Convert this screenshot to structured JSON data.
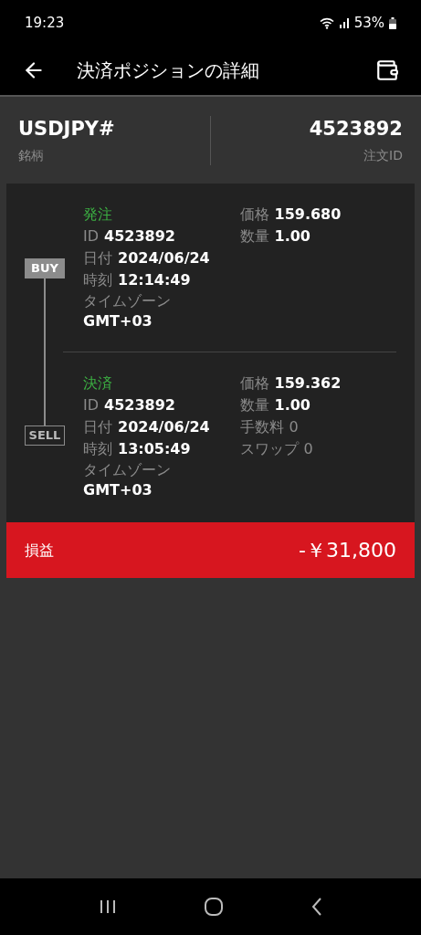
{
  "status_bar": {
    "time": "19:23",
    "battery": "53%"
  },
  "app_bar": {
    "title": "決済ポジションの詳細"
  },
  "summary": {
    "symbol": "USDJPY#",
    "symbol_label": "銘柄",
    "order_id": "4523892",
    "order_id_label": "注文ID"
  },
  "sections": [
    {
      "title": "発注",
      "side": {
        "label": "BUY",
        "kind": "filled"
      },
      "left": [
        {
          "label": "ID",
          "value": "4523892",
          "kind": "inline",
          "emphasis": true
        },
        {
          "label": "日付",
          "value": "2024/06/24",
          "kind": "inline",
          "emphasis": true
        },
        {
          "label": "時刻",
          "value": "12:14:49",
          "kind": "inline",
          "emphasis": true
        },
        {
          "label": "タイムゾーン",
          "value": "GMT+03",
          "kind": "stacked",
          "emphasis": true
        }
      ],
      "right": [
        {
          "label": "価格",
          "value": "159.680",
          "kind": "inline",
          "emphasis": true
        },
        {
          "label": "数量",
          "value": "1.00",
          "kind": "inline",
          "emphasis": true
        }
      ]
    },
    {
      "title": "決済",
      "side": {
        "label": "SELL",
        "kind": "outlined"
      },
      "left": [
        {
          "label": "ID",
          "value": "4523892",
          "kind": "inline",
          "emphasis": true
        },
        {
          "label": "日付",
          "value": "2024/06/24",
          "kind": "inline",
          "emphasis": true
        },
        {
          "label": "時刻",
          "value": "13:05:49",
          "kind": "inline",
          "emphasis": true
        },
        {
          "label": "タイムゾーン",
          "value": "GMT+03",
          "kind": "stacked",
          "emphasis": true
        }
      ],
      "right": [
        {
          "label": "価格",
          "value": "159.362",
          "kind": "inline",
          "emphasis": true
        },
        {
          "label": "数量",
          "value": "1.00",
          "kind": "inline",
          "emphasis": true
        },
        {
          "label": "手数料",
          "value": "0",
          "kind": "inline",
          "emphasis": false
        },
        {
          "label": "スワップ",
          "value": "0",
          "kind": "inline",
          "emphasis": false
        }
      ]
    }
  ],
  "profit": {
    "label": "損益",
    "value": "-￥31,800"
  }
}
